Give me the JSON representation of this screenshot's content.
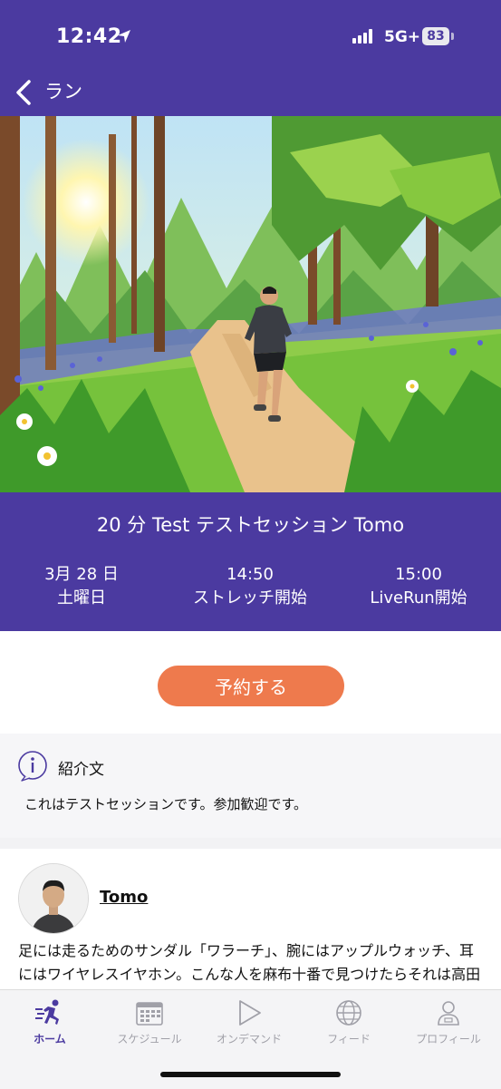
{
  "status_bar": {
    "time": "12:42",
    "network": "5G+",
    "battery": "83"
  },
  "nav": {
    "back_label": "ラン"
  },
  "session": {
    "title": "20 分 Test テストセッション Tomo",
    "date_line1": "3月 28 日",
    "date_line2": "土曜日",
    "stretch_time": "14:50",
    "stretch_label": "ストレッチ開始",
    "live_time": "15:00",
    "live_label": "LiveRun開始"
  },
  "booking": {
    "reserve_label": "予約する"
  },
  "intro": {
    "heading": "紹介文",
    "text": "これはテストセッションです。参加歓迎です。"
  },
  "runner": {
    "name": "Tomo",
    "bio": "足には走るためのサンダル「ワラーチ」、腕にはアップルウォッチ、耳にはワイヤレスイヤホン。こんな人を麻布十番で見つけたらそれは高田智之です。大阪生まれ、シカゴ育ちの起業家"
  },
  "tabs": [
    {
      "label": "ホーム",
      "icon": "home-runner-icon",
      "active": true
    },
    {
      "label": "スケジュール",
      "icon": "calendar-icon",
      "active": false
    },
    {
      "label": "オンデマンド",
      "icon": "play-icon",
      "active": false
    },
    {
      "label": "フィード",
      "icon": "globe-icon",
      "active": false
    },
    {
      "label": "プロフィール",
      "icon": "person-icon",
      "active": false
    }
  ],
  "colors": {
    "brand": "#4b3aa0",
    "accent": "#ee7a4d",
    "inactive": "#a0a0a8"
  }
}
